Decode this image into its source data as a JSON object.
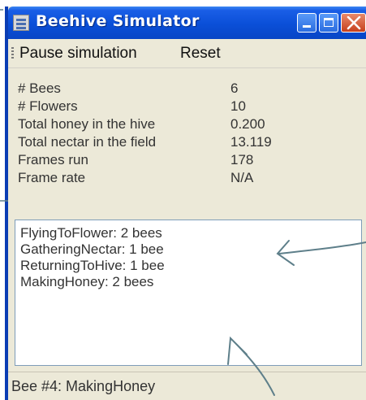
{
  "window": {
    "title": "Beehive Simulator"
  },
  "menu": {
    "items": [
      {
        "label": "Pause simulation"
      },
      {
        "label": "Reset"
      }
    ]
  },
  "stats": [
    {
      "label": "# Bees",
      "value": "6"
    },
    {
      "label": "# Flowers",
      "value": "10"
    },
    {
      "label": "Total honey in the hive",
      "value": "0.200"
    },
    {
      "label": "Total nectar in the field",
      "value": "13.119"
    },
    {
      "label": "Frames run",
      "value": "178"
    },
    {
      "label": "Frame rate",
      "value": "N/A"
    }
  ],
  "list": {
    "items": [
      "FlyingToFlower: 2 bees",
      "GatheringNectar: 1 bee",
      "ReturningToHive: 1 bee",
      "MakingHoney: 2 bees"
    ]
  },
  "status": {
    "text": "Bee #4: MakingHoney"
  },
  "icons": {
    "app": "app-icon",
    "minimize": "minimize-icon",
    "maximize": "maximize-icon",
    "close": "close-icon"
  },
  "colors": {
    "titlebar": "#0a4fd8",
    "window_bg": "#ece9d8",
    "close_button": "#c7401c",
    "annotation_ink": "#5e7f8a"
  }
}
